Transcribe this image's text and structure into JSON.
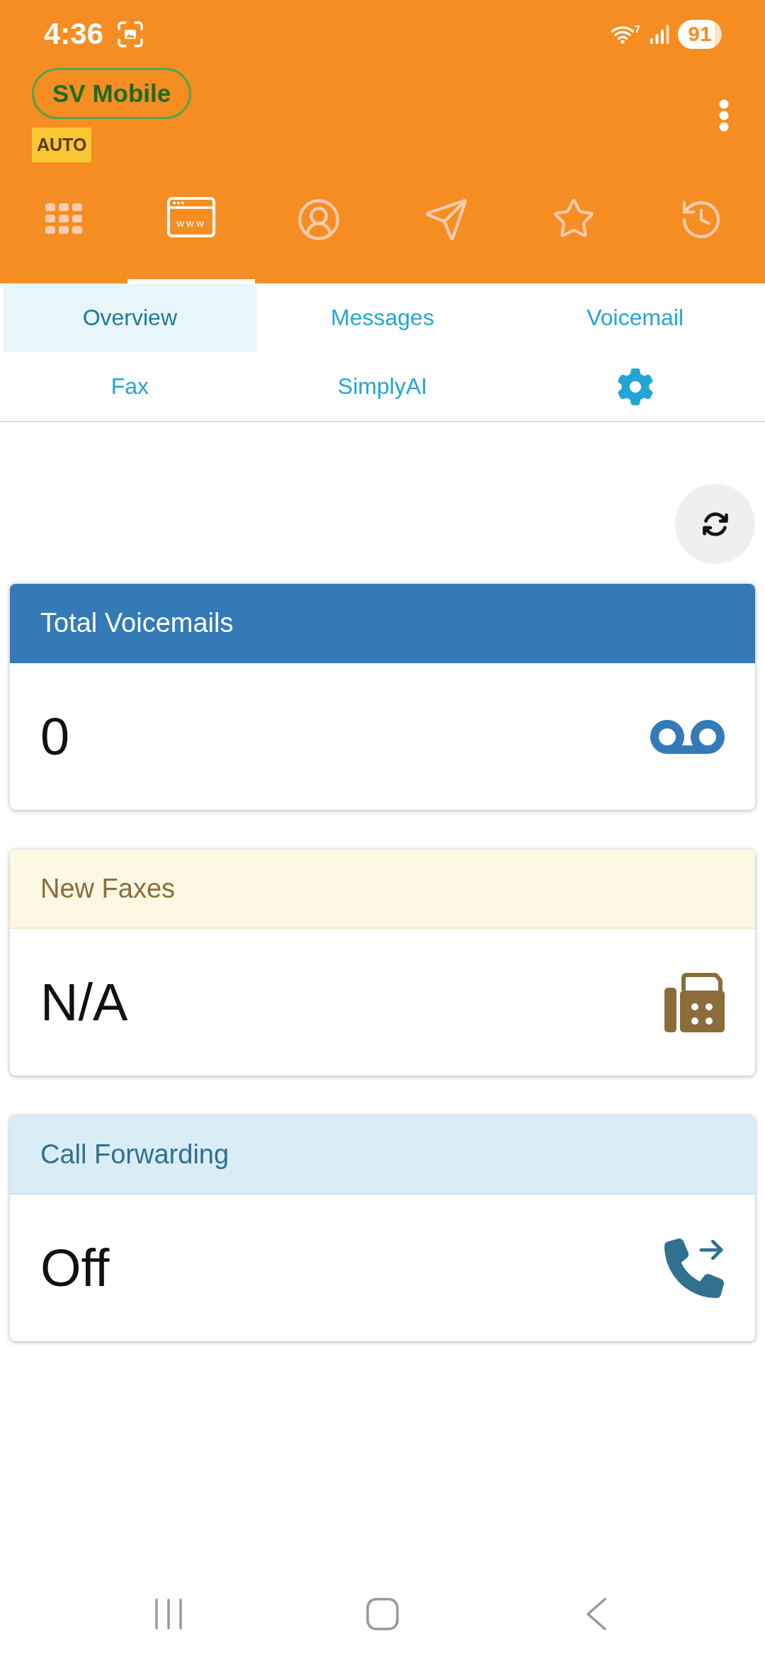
{
  "status_bar": {
    "time": "4:36",
    "wifi_label": "7",
    "battery": "91"
  },
  "header": {
    "account": "SV Mobile",
    "mode": "AUTO",
    "nav": [
      {
        "kind": "dialpad",
        "selected": false
      },
      {
        "kind": "browser",
        "caption": "www",
        "selected": true
      },
      {
        "kind": "contact",
        "selected": false
      },
      {
        "kind": "send",
        "selected": false
      },
      {
        "kind": "favorites",
        "selected": false
      },
      {
        "kind": "history",
        "selected": false
      }
    ]
  },
  "tabs": [
    {
      "kind": "label",
      "label": "Overview",
      "selected": true
    },
    {
      "kind": "label",
      "label": "Messages",
      "selected": false
    },
    {
      "kind": "label",
      "label": "Voicemail",
      "selected": false
    },
    {
      "kind": "label",
      "label": "Fax",
      "selected": false
    },
    {
      "kind": "label",
      "label": "SimplyAI",
      "selected": false
    },
    {
      "kind": "settings",
      "selected": false
    }
  ],
  "cards": [
    {
      "kind": "voicemail",
      "title": "Total Voicemails",
      "value": "0"
    },
    {
      "kind": "fax",
      "title": "New Faxes",
      "value": "N/A"
    },
    {
      "kind": "forwarding",
      "title": "Call Forwarding",
      "value": "Off"
    }
  ]
}
